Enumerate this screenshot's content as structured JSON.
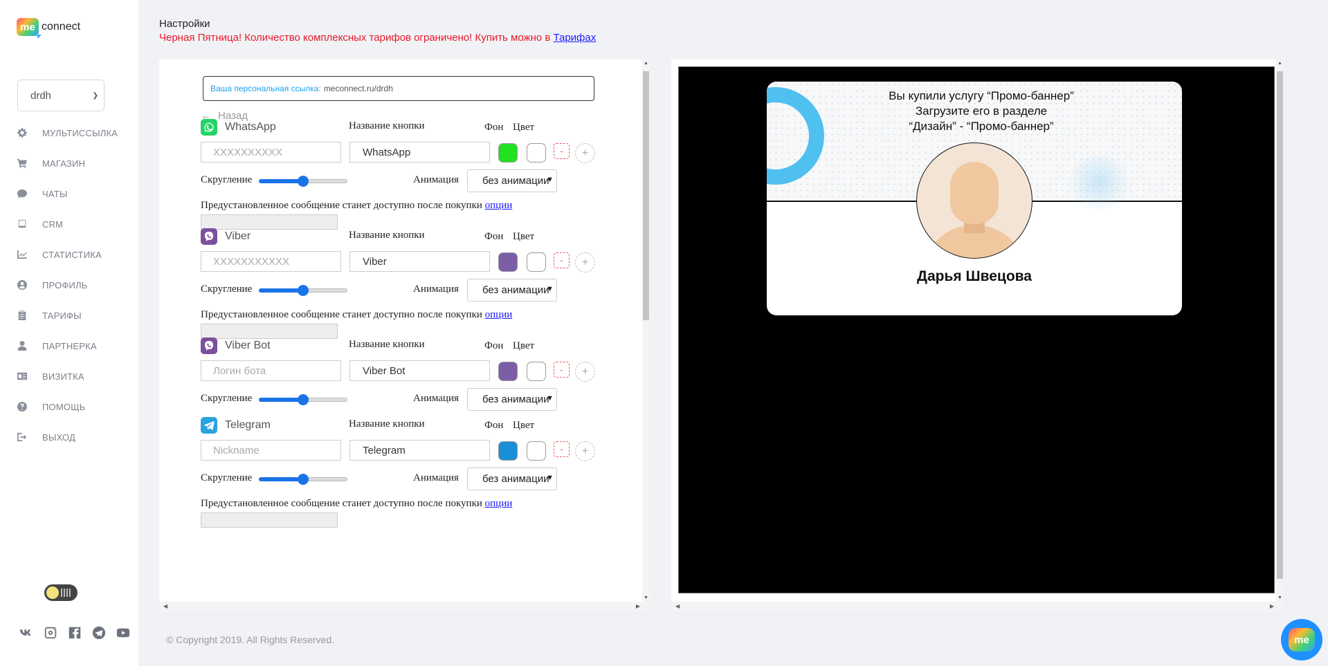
{
  "app": {
    "logo_badge": "me",
    "logo_text": "connect"
  },
  "sidebar": {
    "account": "drdh",
    "items": [
      {
        "label": "МУЛЬТИССЫЛКА",
        "icon": "gear-icon"
      },
      {
        "label": "МАГАЗИН",
        "icon": "cart-icon"
      },
      {
        "label": "ЧАТЫ",
        "icon": "chat-icon"
      },
      {
        "label": "CRM",
        "icon": "book-icon"
      },
      {
        "label": "СТАТИСТИКА",
        "icon": "chart-icon"
      },
      {
        "label": "ПРОФИЛЬ",
        "icon": "user-circle-icon"
      },
      {
        "label": "ТАРИФЫ",
        "icon": "clipboard-icon"
      },
      {
        "label": "ПАРТНЕРКА",
        "icon": "user-icon"
      },
      {
        "label": "ВИЗИТКА",
        "icon": "id-card-icon"
      },
      {
        "label": "ПОМОЩЬ",
        "icon": "question-icon"
      },
      {
        "label": "ВЫХОД",
        "icon": "sign-out-icon"
      }
    ],
    "social": [
      "vk-icon",
      "instagram-icon",
      "facebook-icon",
      "telegram-icon",
      "youtube-icon"
    ]
  },
  "header": {
    "title": "Настройки",
    "promo_text": "Черная Пятница! Количество комплексных тарифов ограничено! Купить можно в ",
    "promo_link": "Тарифах"
  },
  "editor": {
    "link_label": "Ваша персональная ссылка:",
    "link_value": "meconnect.ru/drdh",
    "back_label": "Назад",
    "button_name_label": "Название кнопки",
    "bg_label": "Фон",
    "color_label": "Цвет",
    "rounding_label": "Скругление",
    "animation_label": "Анимация",
    "preset_text": "Предустановленное сообщение станет доступно после покупки ",
    "preset_link": "опции",
    "messengers": [
      {
        "name": "WhatsApp",
        "placeholder": "XXXXXXXXXX",
        "button_name": "WhatsApp",
        "bg": "#22e022",
        "icon_bg": "#25d366",
        "animation": "без анимации",
        "rounding": 0.5,
        "has_preset": true
      },
      {
        "name": "Viber",
        "placeholder": "XXXXXXXXXXX",
        "button_name": "Viber",
        "bg": "#7b5ea7",
        "icon_bg": "#7b519d",
        "animation": "без анимации",
        "rounding": 0.5,
        "has_preset": true
      },
      {
        "name": "Viber Bot",
        "placeholder": "Логин бота",
        "button_name": "Viber Bot",
        "bg": "#7b5ea7",
        "icon_bg": "#7b519d",
        "animation": "без анимации",
        "rounding": 0.5,
        "has_preset": false
      },
      {
        "name": "Telegram",
        "placeholder": "Nickname",
        "button_name": "Telegram",
        "bg": "#1b8ed8",
        "icon_bg": "#2aa3e0",
        "animation": "без анимации",
        "rounding": 0.5,
        "has_preset": true
      }
    ]
  },
  "preview": {
    "promo_line1": "Вы купили услугу “Промо-баннер”",
    "promo_line2": "Загрузите его в разделе",
    "promo_line3": "“Дизайн” - “Промо-баннер”",
    "username": "Дарья Швецова"
  },
  "footer": {
    "copyright": "© Copyright 2019. All Rights Reserved."
  },
  "fab": {
    "label": "me"
  }
}
